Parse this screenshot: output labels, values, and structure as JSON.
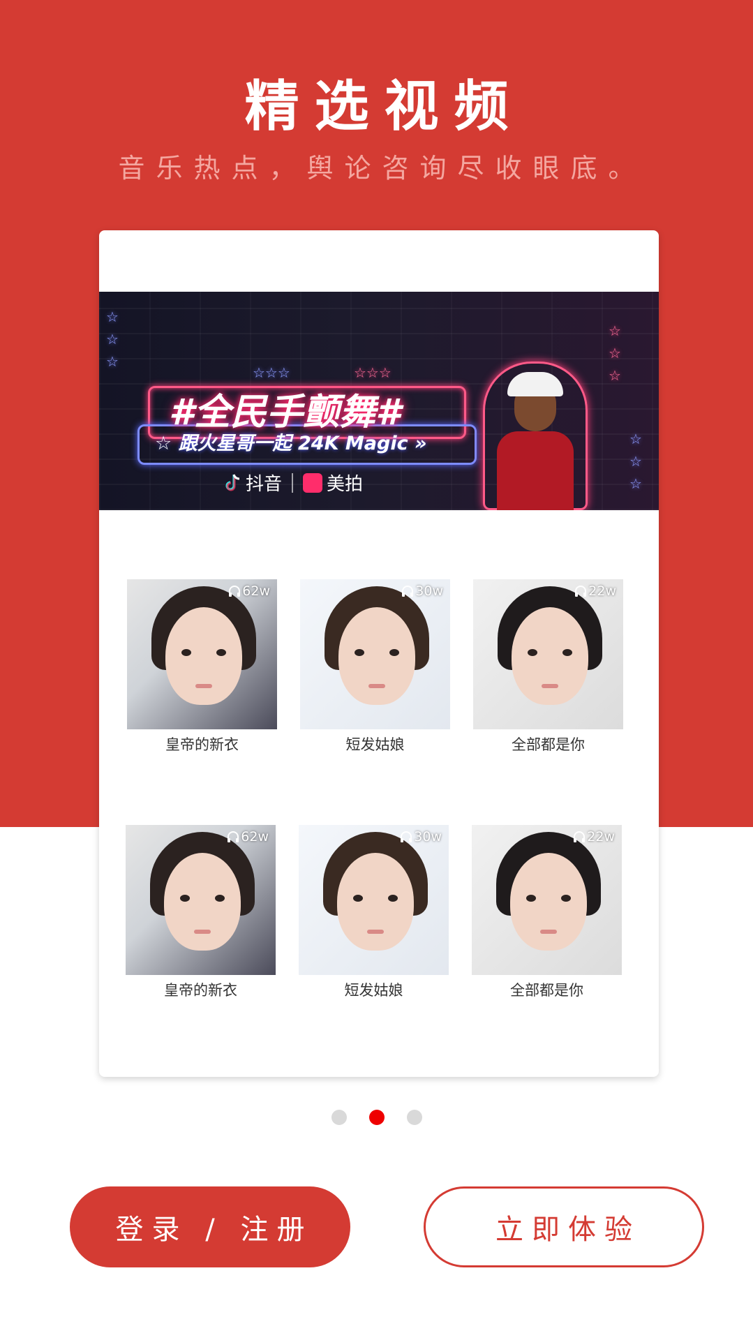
{
  "header": {
    "title": "精选视频",
    "subtitle": "音乐热点，舆论咨询尽收眼底。"
  },
  "banner": {
    "title": "#全民手颤舞#",
    "subtitle": "☆ 跟火星哥一起 24K Magic »",
    "apps": [
      "抖音",
      "美拍"
    ]
  },
  "videos": [
    {
      "caption": "皇帝的新衣",
      "plays": "62w"
    },
    {
      "caption": "短发姑娘",
      "plays": "30w"
    },
    {
      "caption": "全部都是你",
      "plays": "22w"
    },
    {
      "caption": "皇帝的新衣",
      "plays": "62w"
    },
    {
      "caption": "短发姑娘",
      "plays": "30w"
    },
    {
      "caption": "全部都是你",
      "plays": "22w"
    }
  ],
  "pagination": {
    "total": 3,
    "active": 2
  },
  "actions": {
    "login_label": "登录 / 注册",
    "try_label": "立即体验"
  },
  "colors": {
    "brand_red": "#d43b33",
    "dot_active": "#ee0000",
    "dot_inactive": "#d9d9d9"
  }
}
